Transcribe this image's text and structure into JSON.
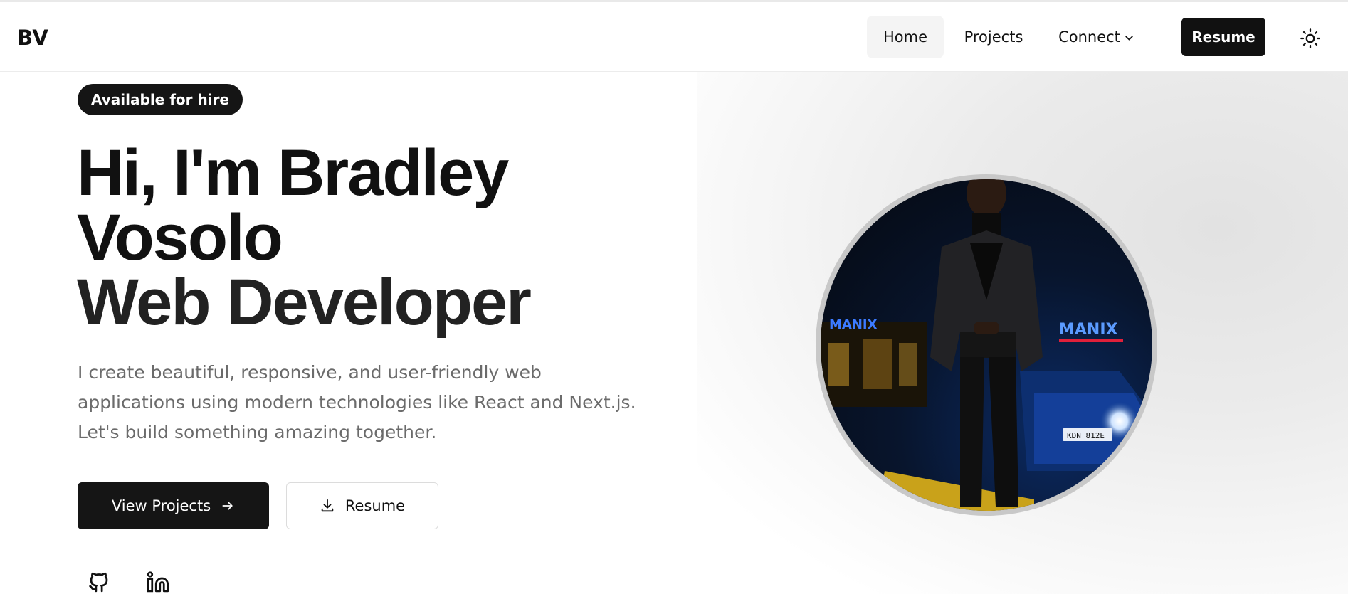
{
  "header": {
    "logo": "BV",
    "nav": [
      {
        "label": "Home",
        "active": true
      },
      {
        "label": "Projects"
      },
      {
        "label": "Connect",
        "has_dropdown": true
      }
    ],
    "resume_button": "Resume",
    "theme_toggle_icon": "sun-icon"
  },
  "hero": {
    "badge": "Available for hire",
    "headline_line1": "Hi, I'm Bradley",
    "headline_line2": "Vosolo",
    "headline_line3": "Web Developer",
    "description_line1": "I create beautiful, responsive, and user-friendly web",
    "description_line2": "applications using modern technologies like React and Next.js.",
    "description_line3": "Let's build something amazing together.",
    "primary_button": "View Projects",
    "primary_button_icon": "arrow-right-icon",
    "secondary_button": "Resume",
    "secondary_button_icon": "download-icon",
    "social_icons": [
      "github-icon",
      "linkedin-icon"
    ],
    "portrait_signs": [
      "MANIX",
      "MANIX"
    ],
    "license_plate": "KDN 812E"
  },
  "colors": {
    "primary": "#151515",
    "text_muted": "#6b6b6b",
    "nav_active_bg": "#f4f4f4",
    "portrait_border": "#c8c8c8"
  }
}
